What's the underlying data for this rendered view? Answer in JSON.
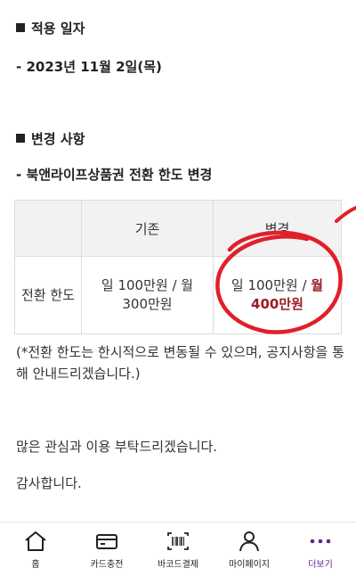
{
  "sections": {
    "date_heading": "적용 일자",
    "date_value": "- 2023년 11월 2일(목)",
    "change_heading": "변경 사항",
    "change_item": "- 북앤라이프상품권 전환 한도 변경"
  },
  "table": {
    "header_old": "기존",
    "header_new": "변경",
    "row_label": "전환 한도",
    "old_value_line1": "일 100만원 / 월",
    "old_value_line2": "300만원",
    "new_value_part1": "일 100만원 / ",
    "new_value_highlight1": "월",
    "new_value_highlight2": "400만원"
  },
  "note": "(*전환 한도는 한시적으로 변동될 수 있으며, 공지사항을 통해 안내드리겠습니다.)",
  "closing": {
    "thanks_request": "많은 관심과 이용 부탁드리겠습니다.",
    "thanks": "감사합니다."
  },
  "tabbar": {
    "home": "홈",
    "card_charge": "카드충전",
    "barcode_pay": "바코드결제",
    "my_page": "마이페이지",
    "more": "더보기"
  },
  "colors": {
    "highlight_text": "#9b1b23",
    "annotation_circle": "#e0202a",
    "more_icon": "#5b2a86"
  }
}
